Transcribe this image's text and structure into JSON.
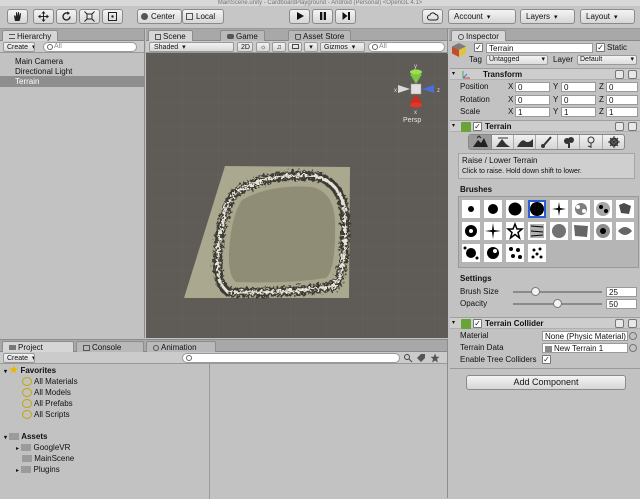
{
  "window": {
    "title": "MainScene.unity - CardboardPlayground - Android (Personal) <OpenGL 4.1>"
  },
  "toolbar": {
    "tools": [
      "hand-tool",
      "move-tool",
      "rotate-tool",
      "scale-tool",
      "rect-tool"
    ],
    "pivot_label": "Center",
    "space_label": "Local",
    "play": [
      "play",
      "pause",
      "step"
    ],
    "cloud": "cloud",
    "account_label": "Account",
    "layers_label": "Layers",
    "layout_label": "Layout"
  },
  "hierarchy": {
    "tab_label": "Hierarchy",
    "create_label": "Create",
    "search_placeholder": "All",
    "items": [
      "Main Camera",
      "Directional Light",
      "Terrain"
    ],
    "selected": "Terrain"
  },
  "scene": {
    "tabs": [
      "Scene",
      "Game",
      "Asset Store"
    ],
    "shading_label": "Shaded",
    "mode_2d": "2D",
    "gizmos_label": "Gizmos",
    "search_placeholder": "All",
    "gizmo": {
      "y": "y",
      "x": "x",
      "z": "z",
      "persp": "Persp"
    }
  },
  "project": {
    "tabs": [
      "Project",
      "Console",
      "Animation"
    ],
    "create_label": "Create",
    "favorites_label": "Favorites",
    "favorites": [
      "All Materials",
      "All Models",
      "All Prefabs",
      "All Scripts"
    ],
    "assets_label": "Assets",
    "assets": [
      "GoogleVR",
      "MainScene",
      "Plugins"
    ]
  },
  "inspector": {
    "tab_label": "Inspector",
    "object_name": "Terrain",
    "static_label": "Static",
    "tag_label": "Tag",
    "tag_value": "Untagged",
    "layer_label": "Layer",
    "layer_value": "Default",
    "transform": {
      "title": "Transform",
      "position_label": "Position",
      "rotation_label": "Rotation",
      "scale_label": "Scale",
      "axis_x": "X",
      "axis_y": "Y",
      "axis_z": "Z",
      "position": [
        "0",
        "0",
        "0"
      ],
      "rotation": [
        "0",
        "0",
        "0"
      ],
      "scale": [
        "1",
        "1",
        "1"
      ]
    },
    "terrain": {
      "title": "Terrain",
      "tool_title": "Raise / Lower Terrain",
      "tool_help": "Click to raise. Hold down shift to lower.",
      "brushes_label": "Brushes",
      "settings_label": "Settings",
      "brush_size_label": "Brush Size",
      "brush_size": "25",
      "brush_size_value": 0.25,
      "opacity_label": "Opacity",
      "opacity": "50",
      "opacity_value": 0.5
    },
    "collider": {
      "title": "Terrain Collider",
      "material_label": "Material",
      "material_value": "None (Physic Material)",
      "data_label": "Terrain Data",
      "data_value": "New Terrain 1",
      "tree_label": "Enable Tree Colliders"
    },
    "add_component_label": "Add Component"
  }
}
